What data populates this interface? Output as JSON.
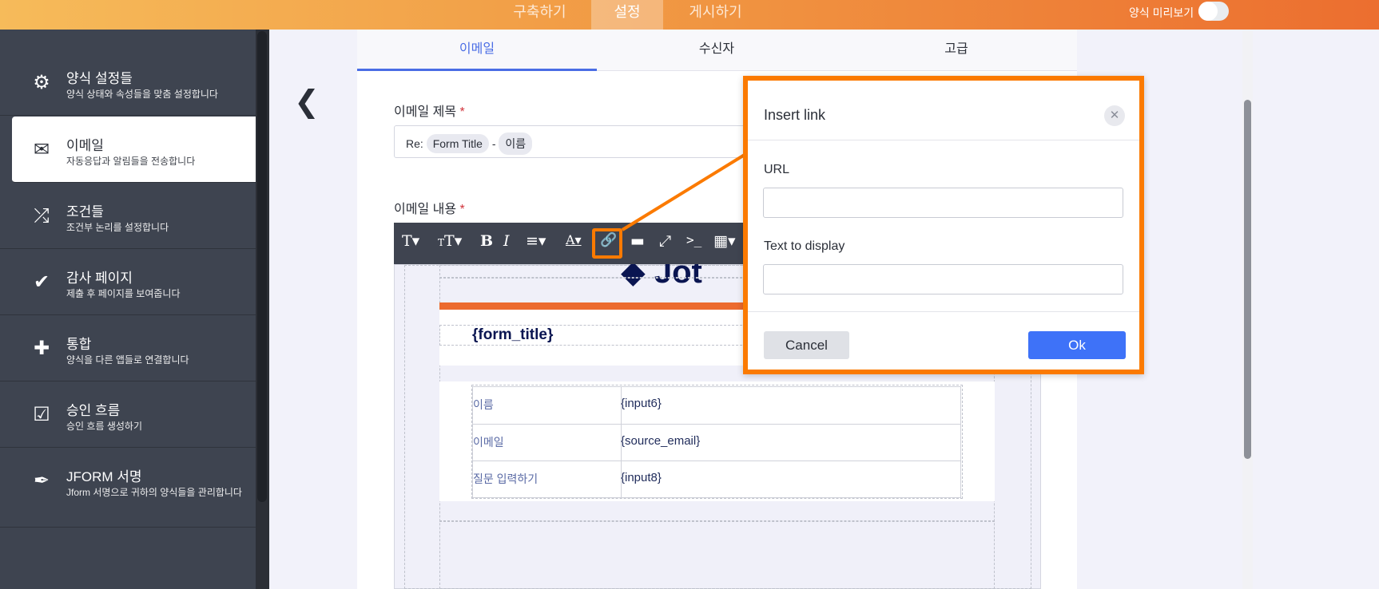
{
  "topbar": {
    "tabs": [
      "구축하기",
      "설정",
      "게시하기"
    ],
    "active": 1,
    "preview_label": "양식 미리보기"
  },
  "sidebar": {
    "items": [
      {
        "icon": "gear-icon",
        "title": "양식 설정들",
        "subtitle": "양식 상태와 속성들을 맞춤 설정합니다"
      },
      {
        "icon": "envelope-icon",
        "title": "이메일",
        "subtitle": "자동응답과 알림들을 전송합니다",
        "active": true
      },
      {
        "icon": "shuffle-icon",
        "title": "조건들",
        "subtitle": "조건부 논리를 설정합니다"
      },
      {
        "icon": "check-circle-icon",
        "title": "감사 페이지",
        "subtitle": "제출 후 페이지를 보여줍니다"
      },
      {
        "icon": "puzzle-icon",
        "title": "통합",
        "subtitle": "양식을 다른 앱들로 연결합니다"
      },
      {
        "icon": "approval-icon",
        "title": "승인 흐름",
        "subtitle": "승인 흐름 생성하기"
      },
      {
        "icon": "signature-icon",
        "title": "JFORM 서명",
        "subtitle": "Jform 서명으로 귀하의 양식들을 관리합니다"
      }
    ]
  },
  "tabs": [
    "이메일",
    "수신자",
    "고급"
  ],
  "subject": {
    "label": "이메일 제목",
    "required": "*",
    "prefix": "Re:",
    "chip1": "Form Title",
    "sep": "-",
    "chip2": "이름"
  },
  "content": {
    "label": "이메일 내용",
    "required": "*"
  },
  "editor": {
    "form_title": "{form_title}",
    "rows": [
      {
        "field": "이름",
        "value": "{input6}"
      },
      {
        "field": "이메일",
        "value": "{source_email}"
      },
      {
        "field": "질문 입력하기",
        "value": "{input8}"
      }
    ]
  },
  "dialog": {
    "title": "Insert link",
    "url_label": "URL",
    "url_value": "",
    "text_label": "Text to display",
    "text_value": "",
    "cancel": "Cancel",
    "ok": "Ok"
  },
  "colors": {
    "accent": "#4a6de5",
    "highlight": "#fb7a00",
    "ok": "#3e72f8"
  }
}
